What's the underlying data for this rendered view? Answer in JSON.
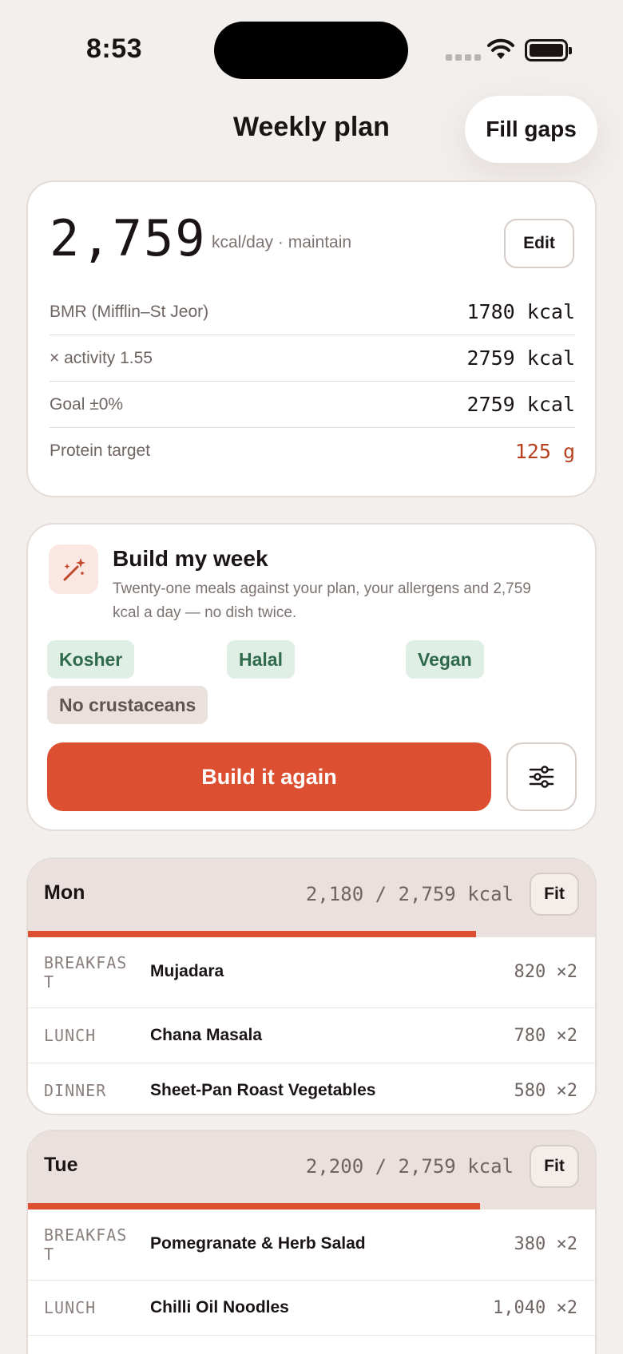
{
  "status_bar": {
    "time": "8:53"
  },
  "header": {
    "title": "Weekly plan",
    "fill_gaps_label": "Fill gaps"
  },
  "summary": {
    "kcal": "2,759",
    "kcal_sub": "kcal/day · maintain",
    "edit_label": "Edit",
    "rows": [
      {
        "label": "BMR (Mifflin–St Jeor)",
        "value": "1780 kcal"
      },
      {
        "label": "× activity 1.55",
        "value": "2759 kcal"
      },
      {
        "label": "Goal ±0%",
        "value": "2759 kcal"
      },
      {
        "label": "Protein target",
        "value": "125 g",
        "accent": true
      }
    ]
  },
  "build": {
    "icon": "magic-wand-icon",
    "title": "Build my week",
    "description": "Twenty-one meals against your plan, your allergens and 2,759 kcal a day — no dish twice.",
    "chips": [
      "Kosher",
      "Halal",
      "Vegan",
      "No crustaceans"
    ],
    "button_label": "Build it again",
    "settings_icon": "sliders-icon"
  },
  "days": [
    {
      "name": "Mon",
      "total": "2,180 / 2,759 kcal",
      "progress": 0.79,
      "fit_label": "Fit",
      "meals": [
        {
          "slot": "BREAKFAST",
          "name": "Mujadara",
          "kcal": "820 ×2"
        },
        {
          "slot": "LUNCH",
          "name": "Chana Masala",
          "kcal": "780 ×2"
        },
        {
          "slot": "DINNER",
          "name": "Sheet-Pan Roast Vegetables",
          "kcal": "580 ×2"
        }
      ]
    },
    {
      "name": "Tue",
      "total": "2,200 / 2,759 kcal",
      "progress": 0.797,
      "fit_label": "Fit",
      "meals": [
        {
          "slot": "BREAKFAST",
          "name": "Pomegranate & Herb Salad",
          "kcal": "380 ×2"
        },
        {
          "slot": "LUNCH",
          "name": "Chilli Oil Noodles",
          "kcal": "1,040 ×2"
        }
      ]
    }
  ],
  "colors": {
    "accent": "#dc4f30",
    "accent_text": "#b7411f",
    "chip_green_bg": "#e0efe6",
    "chip_green_text": "#2f6a4d",
    "background": "#f2efed"
  }
}
